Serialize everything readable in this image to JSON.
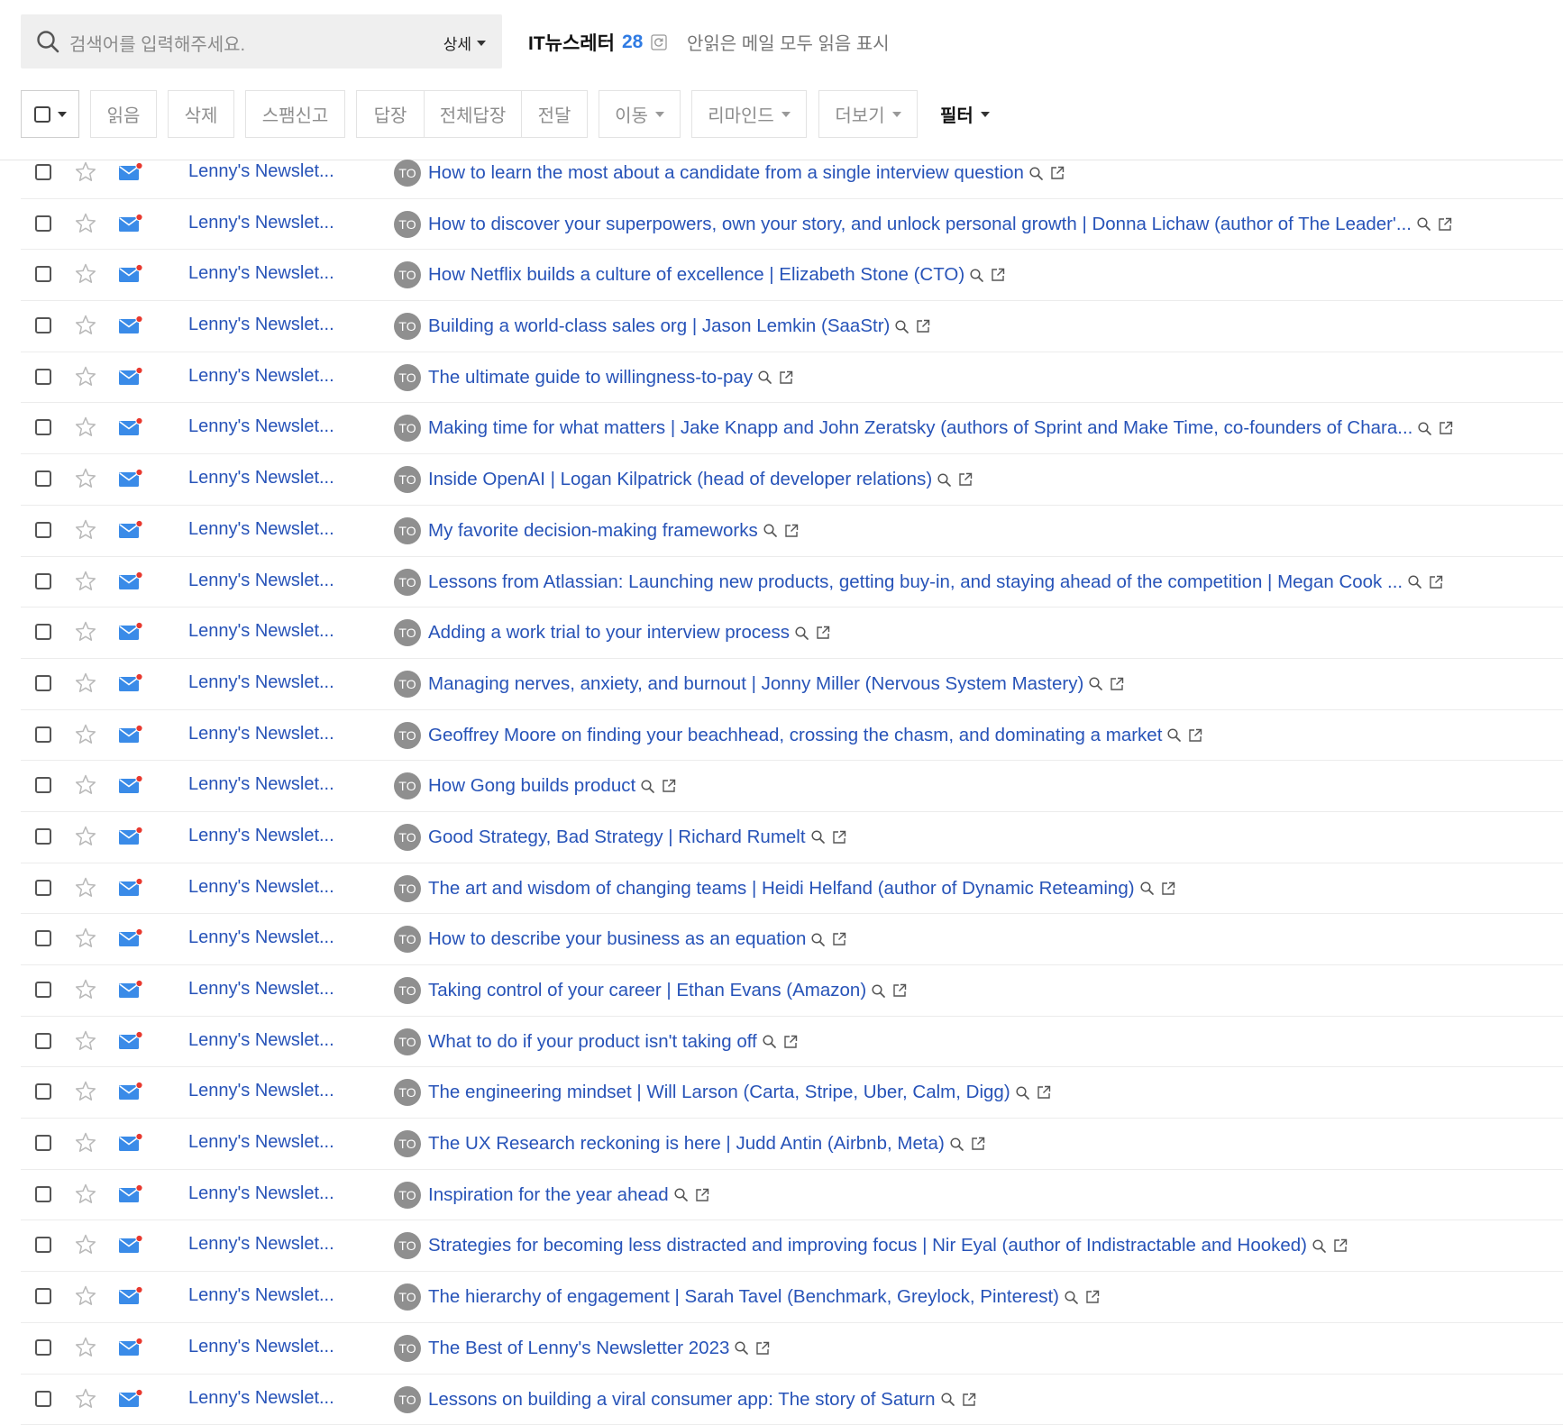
{
  "search": {
    "placeholder": "검색어를 입력해주세요.",
    "detail_label": "상세"
  },
  "folder": {
    "name": "IT뉴스레터",
    "unread_count": "28",
    "mark_all_read": "안읽은 메일 모두 읽음 표시"
  },
  "toolbar": {
    "read": "읽음",
    "delete": "삭제",
    "spam": "스팸신고",
    "reply": "답장",
    "reply_all": "전체답장",
    "forward": "전달",
    "move": "이동",
    "remind": "리마인드",
    "more": "더보기",
    "filter": "필터"
  },
  "badge_label": "TO",
  "colors": {
    "link": "#2753b8",
    "accent": "#2f7be3",
    "unread_dot": "#e8392f",
    "mail_icon": "#3a8be8"
  },
  "messages": [
    {
      "sender": "Lenny's Newslet...",
      "subject": "How to learn the most about a candidate from a single interview question"
    },
    {
      "sender": "Lenny's Newslet...",
      "subject": "How to discover your superpowers, own your story, and unlock personal growth | Donna Lichaw (author of The Leader'..."
    },
    {
      "sender": "Lenny's Newslet...",
      "subject": "How Netflix builds a culture of excellence | Elizabeth Stone (CTO)"
    },
    {
      "sender": "Lenny's Newslet...",
      "subject": "Building a world-class sales org | Jason Lemkin (SaaStr)"
    },
    {
      "sender": "Lenny's Newslet...",
      "subject": "The ultimate guide to willingness-to-pay"
    },
    {
      "sender": "Lenny's Newslet...",
      "subject": "Making time for what matters | Jake Knapp and John Zeratsky (authors of Sprint and Make Time, co-founders of Chara..."
    },
    {
      "sender": "Lenny's Newslet...",
      "subject": "Inside OpenAI | Logan Kilpatrick (head of developer relations)"
    },
    {
      "sender": "Lenny's Newslet...",
      "subject": "My favorite decision-making frameworks"
    },
    {
      "sender": "Lenny's Newslet...",
      "subject": "Lessons from Atlassian: Launching new products, getting buy-in, and staying ahead of the competition | Megan Cook ..."
    },
    {
      "sender": "Lenny's Newslet...",
      "subject": "Adding a work trial to your interview process"
    },
    {
      "sender": "Lenny's Newslet...",
      "subject": "Managing nerves, anxiety, and burnout | Jonny Miller (Nervous System Mastery)"
    },
    {
      "sender": "Lenny's Newslet...",
      "subject": "Geoffrey Moore on finding your beachhead, crossing the chasm, and dominating a market"
    },
    {
      "sender": "Lenny's Newslet...",
      "subject": "How Gong builds product"
    },
    {
      "sender": "Lenny's Newslet...",
      "subject": "Good Strategy, Bad Strategy | Richard Rumelt"
    },
    {
      "sender": "Lenny's Newslet...",
      "subject": "The art and wisdom of changing teams | Heidi Helfand (author of Dynamic Reteaming)"
    },
    {
      "sender": "Lenny's Newslet...",
      "subject": "How to describe your business as an equation"
    },
    {
      "sender": "Lenny's Newslet...",
      "subject": "Taking control of your career | Ethan Evans (Amazon)"
    },
    {
      "sender": "Lenny's Newslet...",
      "subject": "What to do if your product isn't taking off"
    },
    {
      "sender": "Lenny's Newslet...",
      "subject": "The engineering mindset | Will Larson (Carta, Stripe, Uber, Calm, Digg)"
    },
    {
      "sender": "Lenny's Newslet...",
      "subject": "The UX Research reckoning is here | Judd Antin (Airbnb, Meta)"
    },
    {
      "sender": "Lenny's Newslet...",
      "subject": "Inspiration for the year ahead"
    },
    {
      "sender": "Lenny's Newslet...",
      "subject": "Strategies for becoming less distracted and improving focus | Nir Eyal (author of Indistractable and Hooked)"
    },
    {
      "sender": "Lenny's Newslet...",
      "subject": "The hierarchy of engagement | Sarah Tavel (Benchmark, Greylock, Pinterest)"
    },
    {
      "sender": "Lenny's Newslet...",
      "subject": "The Best of Lenny's Newsletter 2023"
    },
    {
      "sender": "Lenny's Newslet...",
      "subject": "Lessons on building a viral consumer app: The story of Saturn"
    }
  ]
}
